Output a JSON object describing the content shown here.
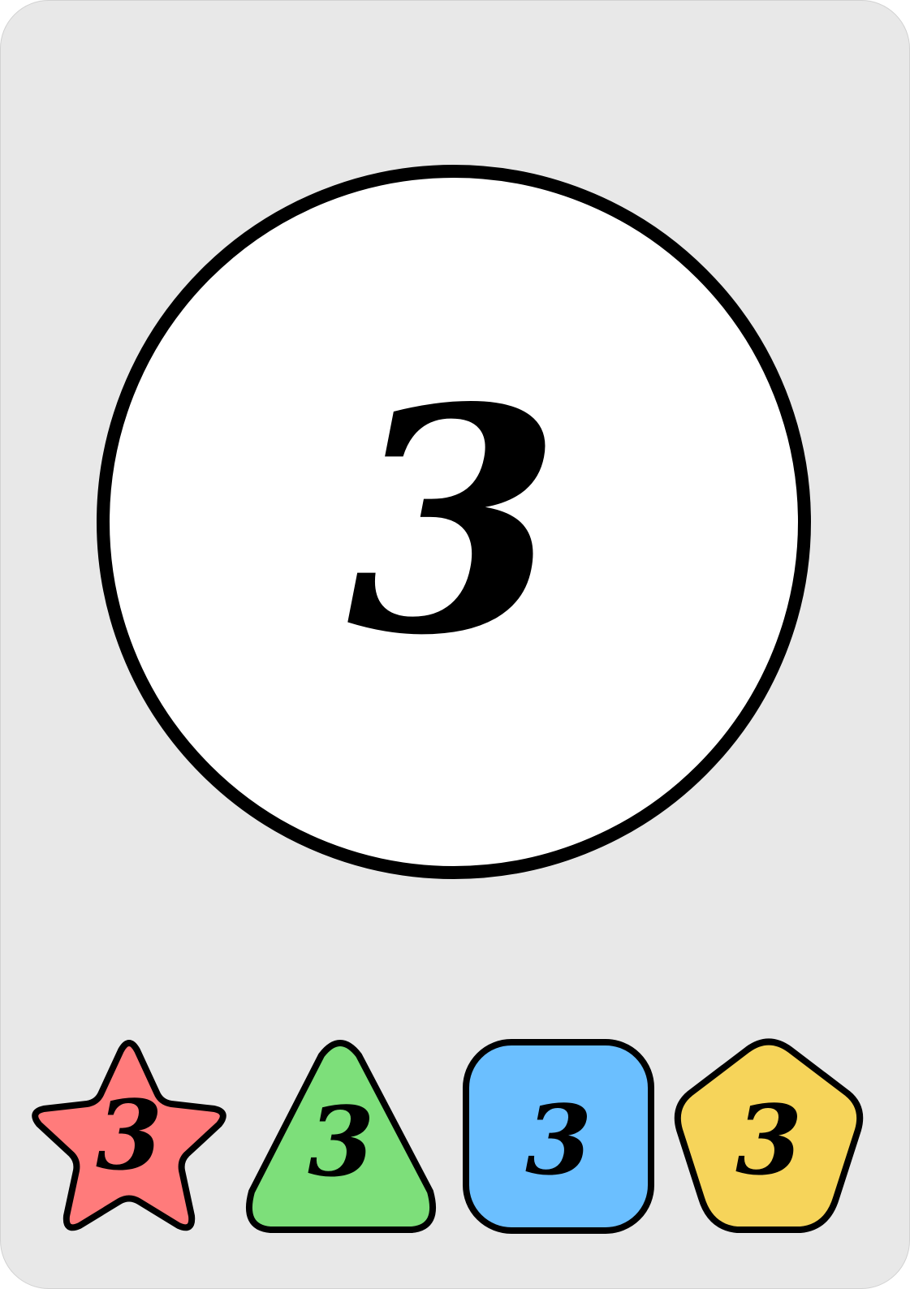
{
  "card": {
    "number": "3",
    "background_color": "#e8e8e8",
    "center_color": "#ffffff",
    "outline_color": "#000000"
  },
  "shapes": [
    {
      "shape": "star",
      "icon": "star-icon",
      "number": "3",
      "color": "#ff7b7b"
    },
    {
      "shape": "triangle",
      "icon": "triangle-icon",
      "number": "3",
      "color": "#7ddf7a"
    },
    {
      "shape": "square",
      "icon": "square-icon",
      "number": "3",
      "color": "#6bbfff"
    },
    {
      "shape": "pentagon",
      "icon": "pentagon-icon",
      "number": "3",
      "color": "#f6d45a"
    }
  ]
}
